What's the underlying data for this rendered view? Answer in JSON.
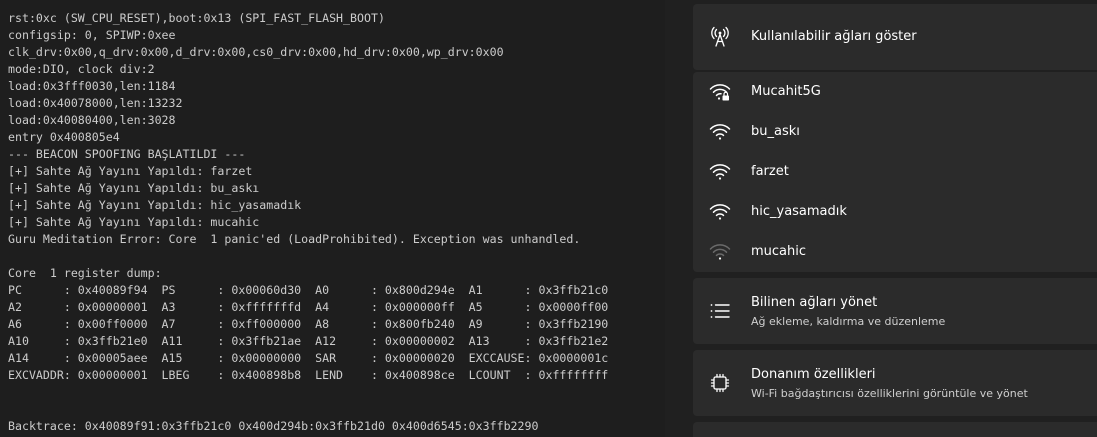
{
  "terminal": {
    "lines": [
      "rst:0xc (SW_CPU_RESET),boot:0x13 (SPI_FAST_FLASH_BOOT)",
      "configsip: 0, SPIWP:0xee",
      "clk_drv:0x00,q_drv:0x00,d_drv:0x00,cs0_drv:0x00,hd_drv:0x00,wp_drv:0x00",
      "mode:DIO, clock div:2",
      "load:0x3fff0030,len:1184",
      "load:0x40078000,len:13232",
      "load:0x40080400,len:3028",
      "entry 0x400805e4",
      "--- BEACON SPOOFING BAŞLATILDI ---",
      "[+] Sahte Ağ Yayını Yapıldı: farzet",
      "[+] Sahte Ağ Yayını Yapıldı: bu_askı",
      "[+] Sahte Ağ Yayını Yapıldı: hic_yasamadık",
      "[+] Sahte Ağ Yayını Yapıldı: mucahic",
      "Guru Meditation Error: Core  1 panic'ed (LoadProhibited). Exception was unhandled.",
      "",
      "Core  1 register dump:",
      "PC      : 0x40089f94  PS      : 0x00060d30  A0      : 0x800d294e  A1      : 0x3ffb21c0",
      "A2      : 0x00000001  A3      : 0xfffffffd  A4      : 0x000000ff  A5      : 0x0000ff00",
      "A6      : 0x00ff0000  A7      : 0xff000000  A8      : 0x800fb240  A9      : 0x3ffb2190",
      "A10     : 0x3ffb21e0  A11     : 0x3ffb21ae  A12     : 0x00000002  A13     : 0x3ffb21e2",
      "A14     : 0x00005aee  A15     : 0x00000000  SAR     : 0x00000020  EXCCAUSE: 0x0000001c",
      "EXCVADDR: 0x00000001  LBEG    : 0x400898b8  LEND    : 0x400898ce  LCOUNT  : 0xffffffff",
      "",
      "",
      "Backtrace: 0x40089f91:0x3ffb21c0 0x400d294b:0x3ffb21d0 0x400d6545:0x3ffb2290"
    ]
  },
  "wifi_panel": {
    "show_networks": {
      "label": "Kullanılabilir ağları göster",
      "icon": "antenna-icon"
    },
    "networks": [
      {
        "ssid": "Mucahit5G",
        "icon": "wifi-secured-icon",
        "signal": 1.0
      },
      {
        "ssid": "bu_askı",
        "icon": "wifi-icon",
        "signal": 1.0
      },
      {
        "ssid": "farzet",
        "icon": "wifi-icon",
        "signal": 1.0
      },
      {
        "ssid": "hic_yasamadık",
        "icon": "wifi-icon",
        "signal": 1.0
      },
      {
        "ssid": "mucahic",
        "icon": "wifi-weak-icon",
        "signal": 0.25
      }
    ],
    "manage_known": {
      "title": "Bilinen ağları yönet",
      "subtitle": "Ağ ekleme, kaldırma ve düzenleme",
      "icon": "list-icon"
    },
    "hardware": {
      "title": "Donanım özellikleri",
      "subtitle": "Wi-Fi bağdaştırıcısı özelliklerini görüntüle ve yönet",
      "icon": "chip-icon"
    }
  },
  "colors": {
    "terminal_bg": "#1e1e1e",
    "terminal_text": "#cccccc",
    "panel_bg": "#202020",
    "card_bg": "#2b2b2b",
    "text_primary": "#ffffff",
    "text_secondary": "#cfcfcf"
  }
}
